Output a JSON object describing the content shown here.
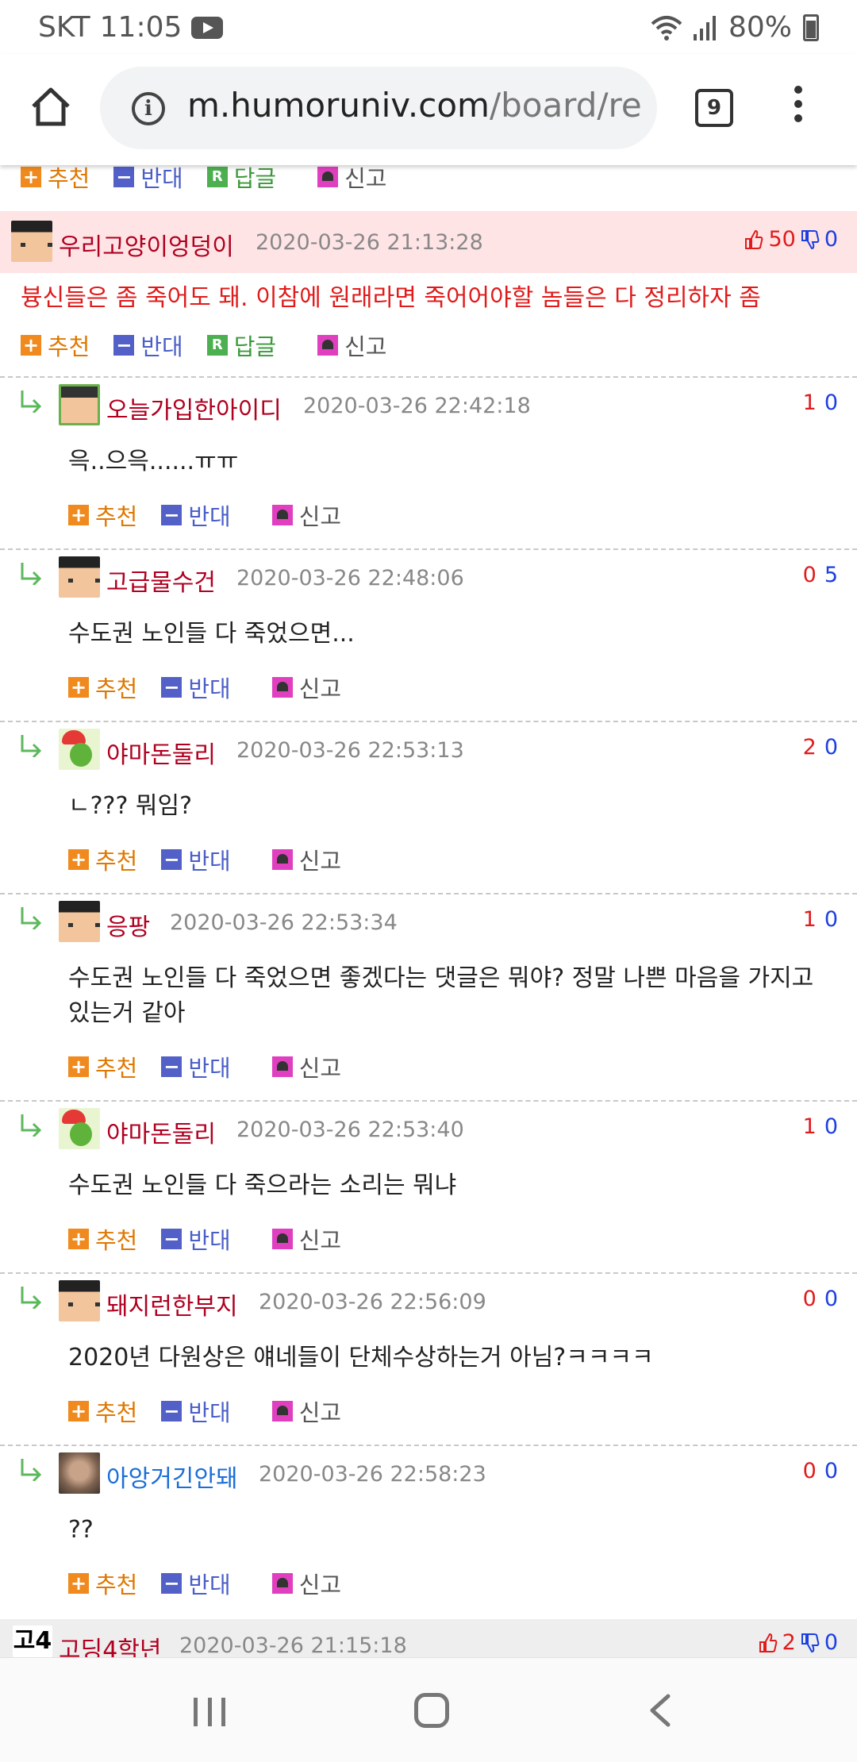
{
  "status_bar": {
    "carrier": "SKT",
    "time": "11:05",
    "battery": "80%"
  },
  "browser": {
    "url_host": "m.humoruniv.com",
    "url_path": "/board/re",
    "tab_count": "9"
  },
  "actions": {
    "up": "추천",
    "down": "반대",
    "reply": "답글",
    "report": "신고"
  },
  "posts": [
    {
      "nick": "우리고양이엉덩이",
      "date": "2020-03-26 21:13:28",
      "up": "50",
      "down": "0",
      "text": "븅신들은 좀 죽어도 돼. 이참에 원래라면 죽어어야할 놈들은 다 정리하자 좀"
    },
    {
      "nick": "고딩4학년",
      "date": "2020-03-26 21:15:18",
      "up": "2",
      "down": "0",
      "avatar_text": "고4"
    }
  ],
  "replies": [
    {
      "nick": "오늘가입한아이디",
      "date": "2020-03-26 22:42:18",
      "up": "1",
      "down": "0",
      "text": "윽..으윽......ㅠㅠ",
      "avatar": "new-member-avatar"
    },
    {
      "nick": "고급물수건",
      "date": "2020-03-26 22:48:06",
      "up": "0",
      "down": "5",
      "text": "수도권 노인들 다 죽었으면...",
      "avatar": "graduate-avatar"
    },
    {
      "nick": "야마돈둘리",
      "date": "2020-03-26 22:53:13",
      "up": "2",
      "down": "0",
      "text": "ㄴ??? 뭐임?",
      "avatar": "dino-avatar"
    },
    {
      "nick": "응팡",
      "date": "2020-03-26 22:53:34",
      "up": "1",
      "down": "0",
      "text": "수도권 노인들 다 죽었으면 좋겠다는 댓글은 뭐야? 정말 나쁜 마음을 가지고 있는거 같아",
      "avatar": "graduate-avatar"
    },
    {
      "nick": "야마돈둘리",
      "date": "2020-03-26 22:53:40",
      "up": "1",
      "down": "0",
      "text": "수도권 노인들 다 죽으라는 소리는 뭐냐",
      "avatar": "dino-avatar"
    },
    {
      "nick": "돼지런한부지",
      "date": "2020-03-26 22:56:09",
      "up": "0",
      "down": "0",
      "text": "2020년 다원상은 얘네들이 단체수상하는거 아님?ㅋㅋㅋㅋ",
      "avatar": "graduate-avatar"
    },
    {
      "nick": "아앙거긴안돼",
      "date": "2020-03-26 22:58:23",
      "up": "0",
      "down": "0",
      "text": "??",
      "avatar": "dog-photo-avatar"
    }
  ],
  "colors": {
    "highlight_row": "#ffe4e6",
    "vote_up": "#e01b1b",
    "vote_down": "#1b3fe0",
    "nick": "#b00020",
    "nick_blue": "#1a6ed8"
  }
}
